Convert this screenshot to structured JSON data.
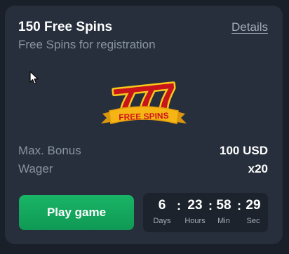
{
  "card": {
    "title": "150 Free Spins",
    "details_link": "Details",
    "subtitle": "Free Spins for registration"
  },
  "logo": {
    "digits": "777",
    "ribbon_text": "FREE SPINS",
    "colors": {
      "digit_fill": "#c8151b",
      "digit_outline": "#f6c91c",
      "ribbon": "#f5b515",
      "ribbon_text": "#d0161c"
    }
  },
  "info": {
    "max_bonus_label": "Max. Bonus",
    "max_bonus_value": "100 USD",
    "wager_label": "Wager",
    "wager_value": "x20"
  },
  "actions": {
    "play_label": "Play game"
  },
  "timer": {
    "days": "6",
    "hours": "23",
    "minutes": "58",
    "seconds": "29",
    "days_label": "Days",
    "hours_label": "Hours",
    "minutes_label": "Min",
    "seconds_label": "Sec",
    "separator": ":"
  },
  "colors": {
    "page_bg": "#1a2029",
    "card_bg": "#272f3c",
    "timer_bg": "#1c232d",
    "accent_green": "#13a85d",
    "muted_text": "#8a93a2"
  }
}
